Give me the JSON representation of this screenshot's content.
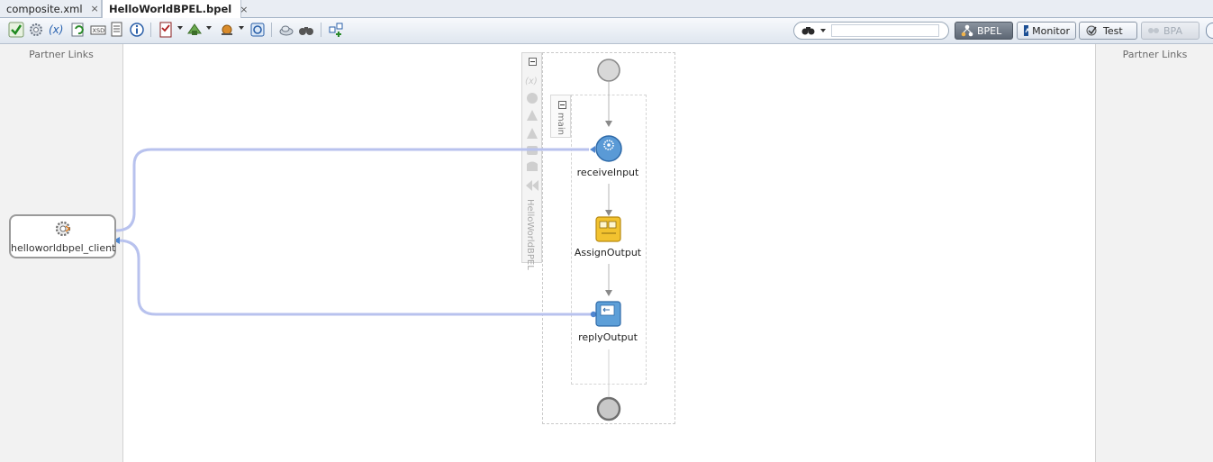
{
  "tabs": [
    {
      "label": "composite.xml",
      "close": "×",
      "icon": "composite-icon"
    },
    {
      "label": "HelloWorldBPEL.bpel",
      "close": "×",
      "icon": "bpel-icon",
      "active": true
    }
  ],
  "toolbar": {
    "icons": [
      "validate-icon",
      "gear-icon",
      "variable-icon",
      "refresh-icon",
      "xsd-icon",
      "schema-icon",
      "info-icon",
      "checklist-icon",
      "deploy-icon",
      "adapter-icon",
      "sync-icon",
      "cloud-icon",
      "binoculars-icon",
      "add-icon"
    ],
    "search": {
      "value": "",
      "icon": "binoculars-icon"
    },
    "modes": {
      "bpel": "BPEL",
      "monitor": "Monitor",
      "test": "Test",
      "bpa": "BPA"
    }
  },
  "left_panel": {
    "title": "Partner Links"
  },
  "right_panel": {
    "title": "Partner Links"
  },
  "partner_link": {
    "label": "helloworldbpel_client"
  },
  "process": {
    "name": "HelloWorldBPEL",
    "scope": "main",
    "activities": [
      {
        "label": "receiveInput",
        "type": "receive"
      },
      {
        "label": "AssignOutput",
        "type": "assign"
      },
      {
        "label": "replyOutput",
        "type": "reply"
      }
    ]
  },
  "colors": {
    "link_line": "#b8c2ee",
    "receive": "#5a9ad6",
    "assign": "#f2c22f",
    "reply": "#5d9fd8",
    "toggle_on": "#6a737f"
  }
}
